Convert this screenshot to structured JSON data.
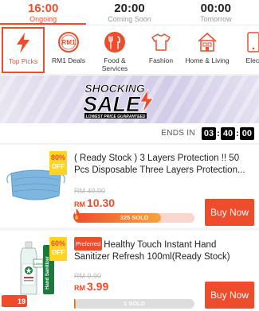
{
  "time_tabs": [
    {
      "time": "16:00",
      "status": "Ongoing"
    },
    {
      "time": "20:00",
      "status": "Coming Soon"
    },
    {
      "time": "00:00",
      "status": "Tomorrow"
    }
  ],
  "categories": [
    {
      "label": "Top Picks",
      "icon": "flash-icon"
    },
    {
      "label": "RM1 Deals",
      "icon": "rm1-icon"
    },
    {
      "label": "Food & Services",
      "icon": "food-icon"
    },
    {
      "label": "Fashion",
      "icon": "shirt-icon"
    },
    {
      "label": "Home & Living",
      "icon": "house-icon"
    },
    {
      "label": "Elect",
      "icon": "electronics-icon"
    }
  ],
  "banner": {
    "line1": "SHOCKING",
    "line2": "SALE",
    "tagline": "LOWEST PRICE GUARANTEED"
  },
  "countdown": {
    "label": "ENDS IN",
    "h": "03",
    "m": "40",
    "s": "00"
  },
  "products": [
    {
      "title": "( Ready Stock ) 3 Layers Protection !! 50 Pcs Disposable Three Layers Protection...",
      "preferred": "",
      "discount": "80%",
      "discount_off": "OFF",
      "old_price": "RM 49.90",
      "currency": "RM",
      "price": "10.30",
      "sold": "325 SOLD",
      "sold_fraction": 0.72,
      "buy": "Buy Now"
    },
    {
      "title": "Healthy Touch Instant Hand Sanitizer Refresh 100ml(Ready Stock)",
      "preferred": "Preferred",
      "discount": "60%",
      "discount_off": "OFF",
      "old_price": "RM 9.90",
      "currency": "RM",
      "price": "3.99",
      "sold": "1 SOLD",
      "sold_fraction": 0.01,
      "buy": "Buy Now"
    }
  ],
  "corner_badge": "19",
  "colors": {
    "accent": "#ee4d2d",
    "discount_bg": "#ffd424"
  }
}
